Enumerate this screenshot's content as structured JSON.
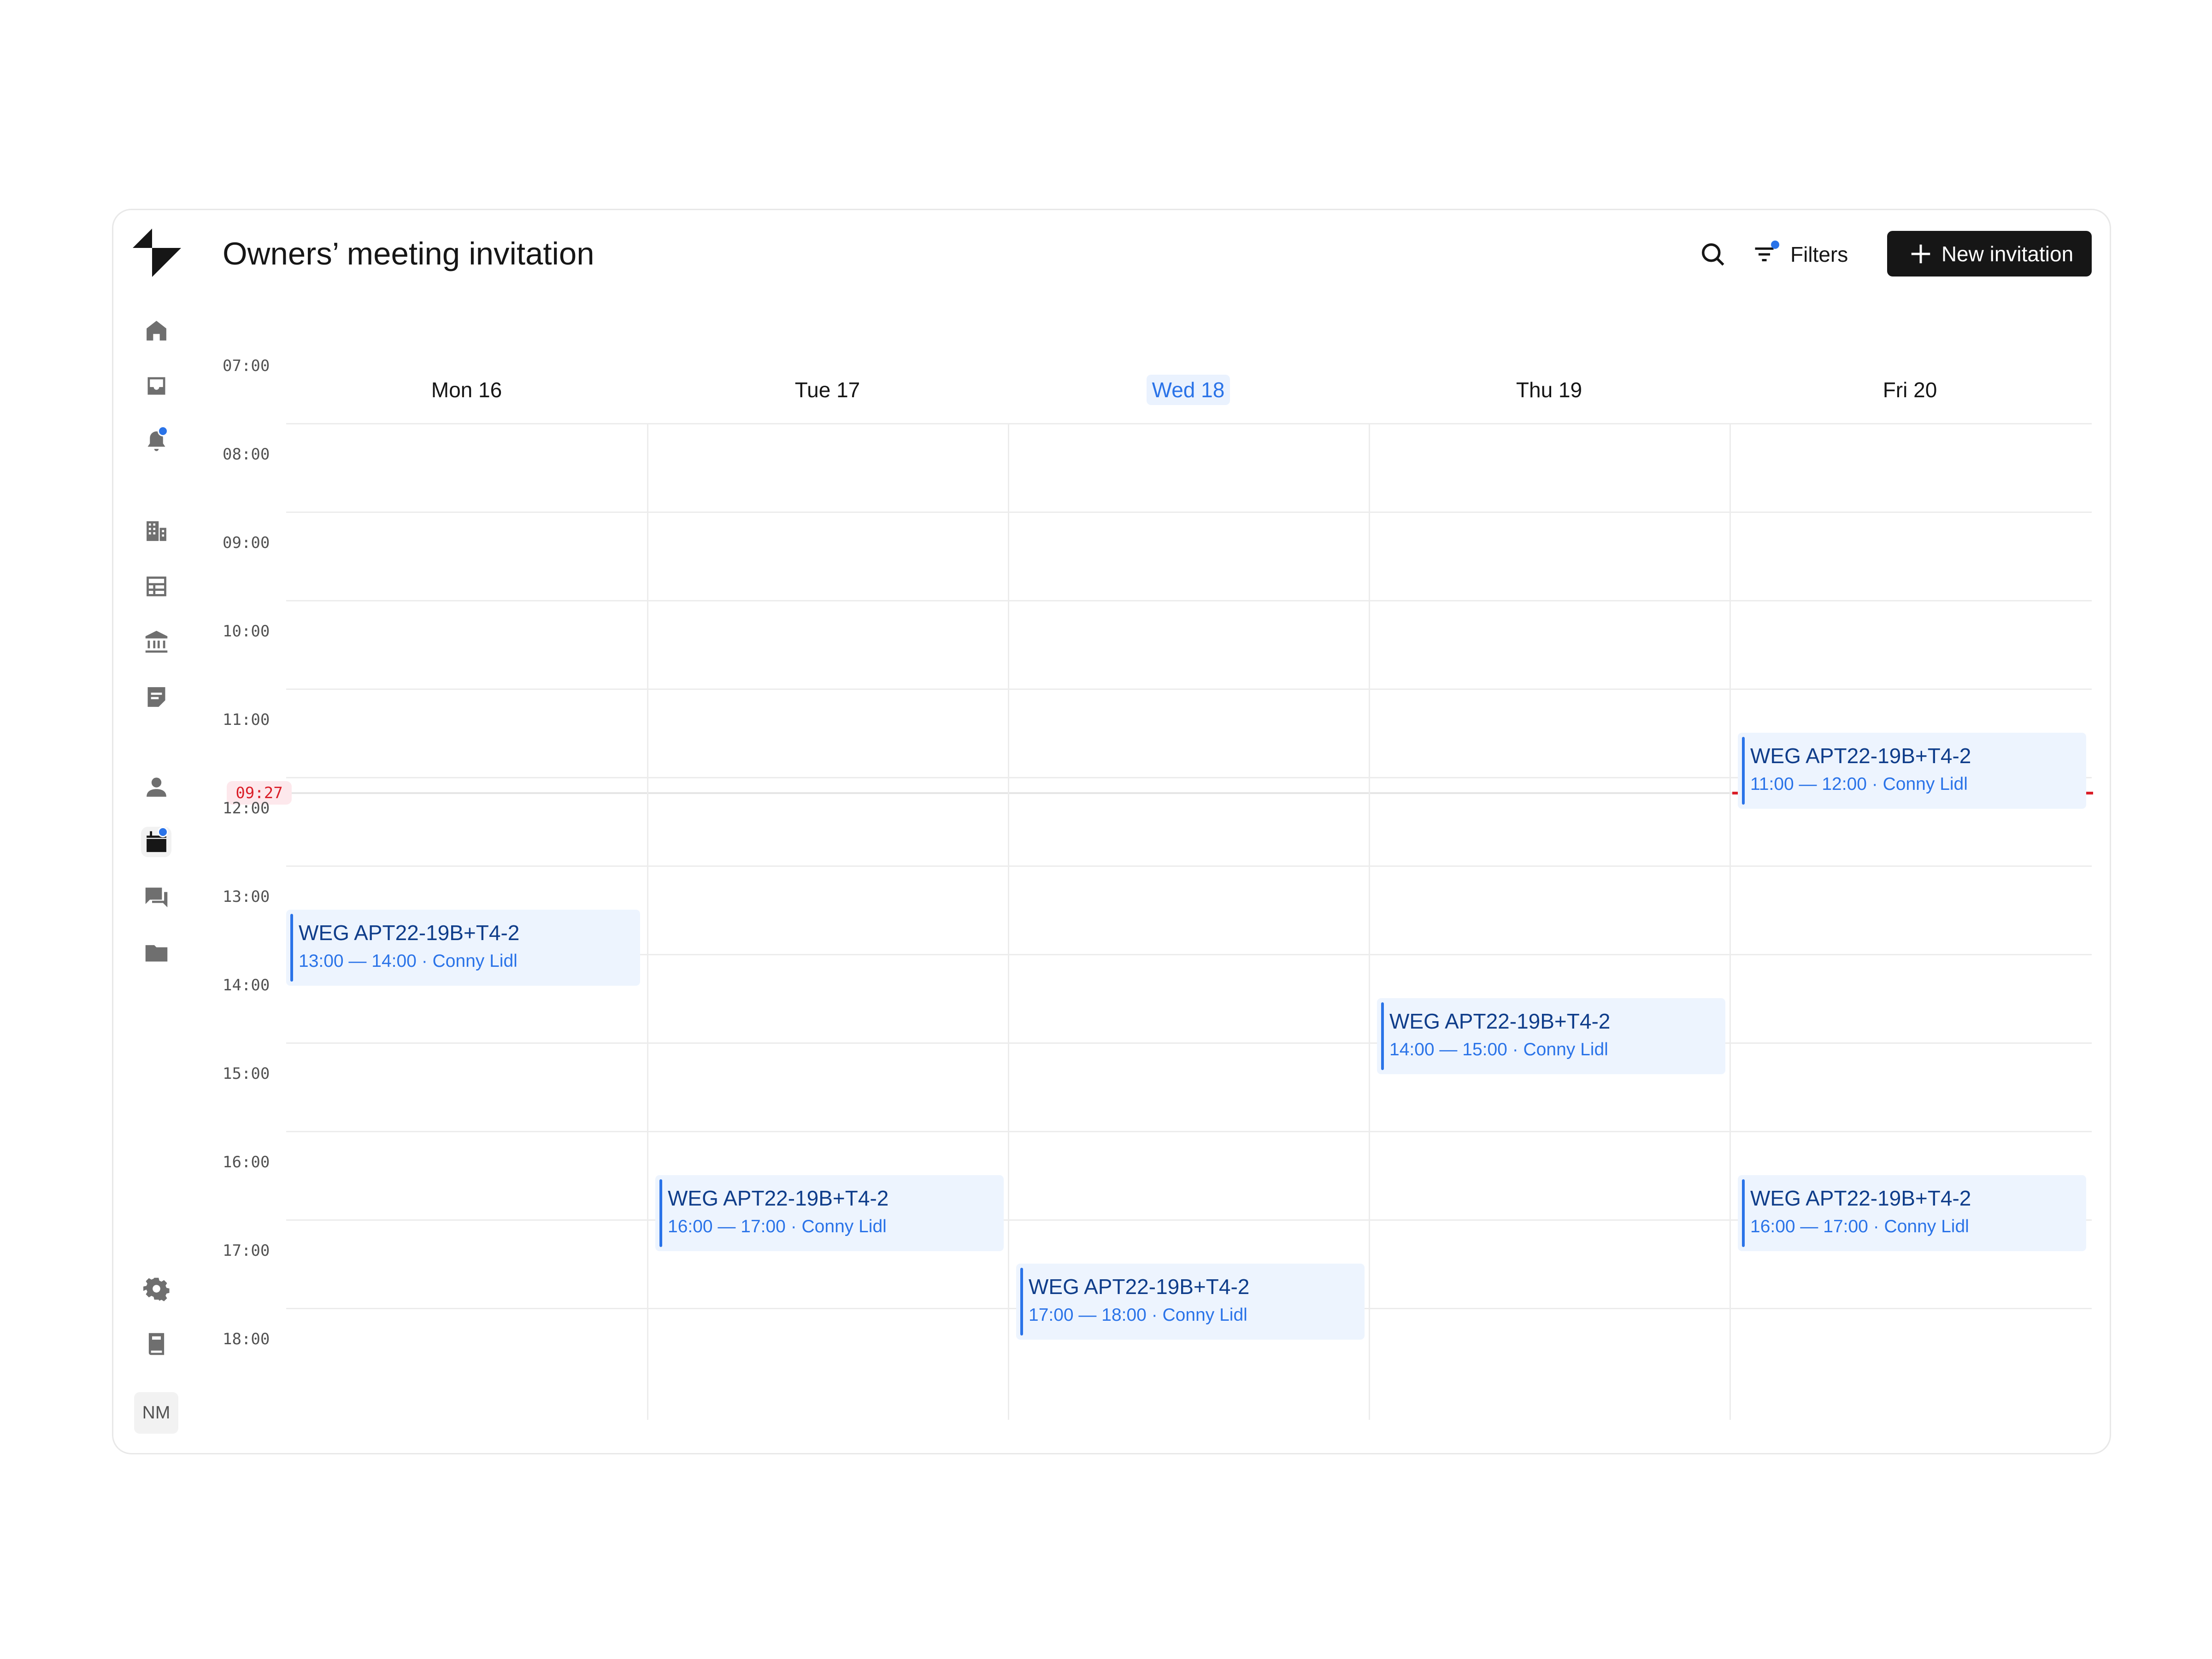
{
  "header": {
    "title": "Owners’ meeting invitation",
    "filters_label": "Filters",
    "new_invitation_label": "New invitation",
    "search_icon": "search-icon",
    "filter_icon": "filter-icon",
    "plus_icon": "plus-icon"
  },
  "sidebar": {
    "logo": "app-logo",
    "items": [
      {
        "icon": "home-icon",
        "active": false,
        "dot": false
      },
      {
        "icon": "inbox-icon",
        "active": false,
        "dot": false
      },
      {
        "icon": "bell-icon",
        "active": false,
        "dot": true
      },
      {
        "icon": "building-icon",
        "active": false,
        "dot": false
      },
      {
        "icon": "table-icon",
        "active": false,
        "dot": false
      },
      {
        "icon": "bank-icon",
        "active": false,
        "dot": false
      },
      {
        "icon": "document-icon",
        "active": false,
        "dot": false
      },
      {
        "icon": "person-icon",
        "active": false,
        "dot": false
      },
      {
        "icon": "calendar-icon",
        "active": true,
        "dot": true
      },
      {
        "icon": "chat-icon",
        "active": false,
        "dot": false
      },
      {
        "icon": "folder-icon",
        "active": false,
        "dot": false
      },
      {
        "icon": "settings-icon",
        "active": false,
        "dot": false
      },
      {
        "icon": "book-icon",
        "active": false,
        "dot": false
      }
    ],
    "avatar_initials": "NM"
  },
  "calendar": {
    "days": [
      {
        "label": "Mon 16",
        "today": false
      },
      {
        "label": "Tue 17",
        "today": false
      },
      {
        "label": "Wed 18",
        "today": true
      },
      {
        "label": "Thu 19",
        "today": false
      },
      {
        "label": "Fri 20",
        "today": false
      }
    ],
    "hours": [
      "07:00",
      "08:00",
      "09:00",
      "10:00",
      "11:00",
      "12:00",
      "13:00",
      "14:00",
      "15:00",
      "16:00",
      "17:00",
      "18:00"
    ],
    "now_label": "09:27",
    "events": [
      {
        "title": "WEG APT22-19B+T4-2",
        "time": "11:00 — 12:00 · Conny Lidl"
      },
      {
        "title": "WEG APT22-19B+T4-2",
        "time": "13:00 — 14:00 · Conny Lidl"
      },
      {
        "title": "WEG APT22-19B+T4-2",
        "time": "14:00 — 15:00 · Conny Lidl"
      },
      {
        "title": "WEG APT22-19B+T4-2",
        "time": "16:00 — 17:00 · Conny Lidl"
      },
      {
        "title": "WEG APT22-19B+T4-2",
        "time": "16:00 — 17:00 · Conny Lidl"
      },
      {
        "title": "WEG APT22-19B+T4-2",
        "time": "17:00 — 18:00 · Conny Lidl"
      }
    ],
    "accent_color": "#2a73e8",
    "now_color": "#da1e28"
  }
}
